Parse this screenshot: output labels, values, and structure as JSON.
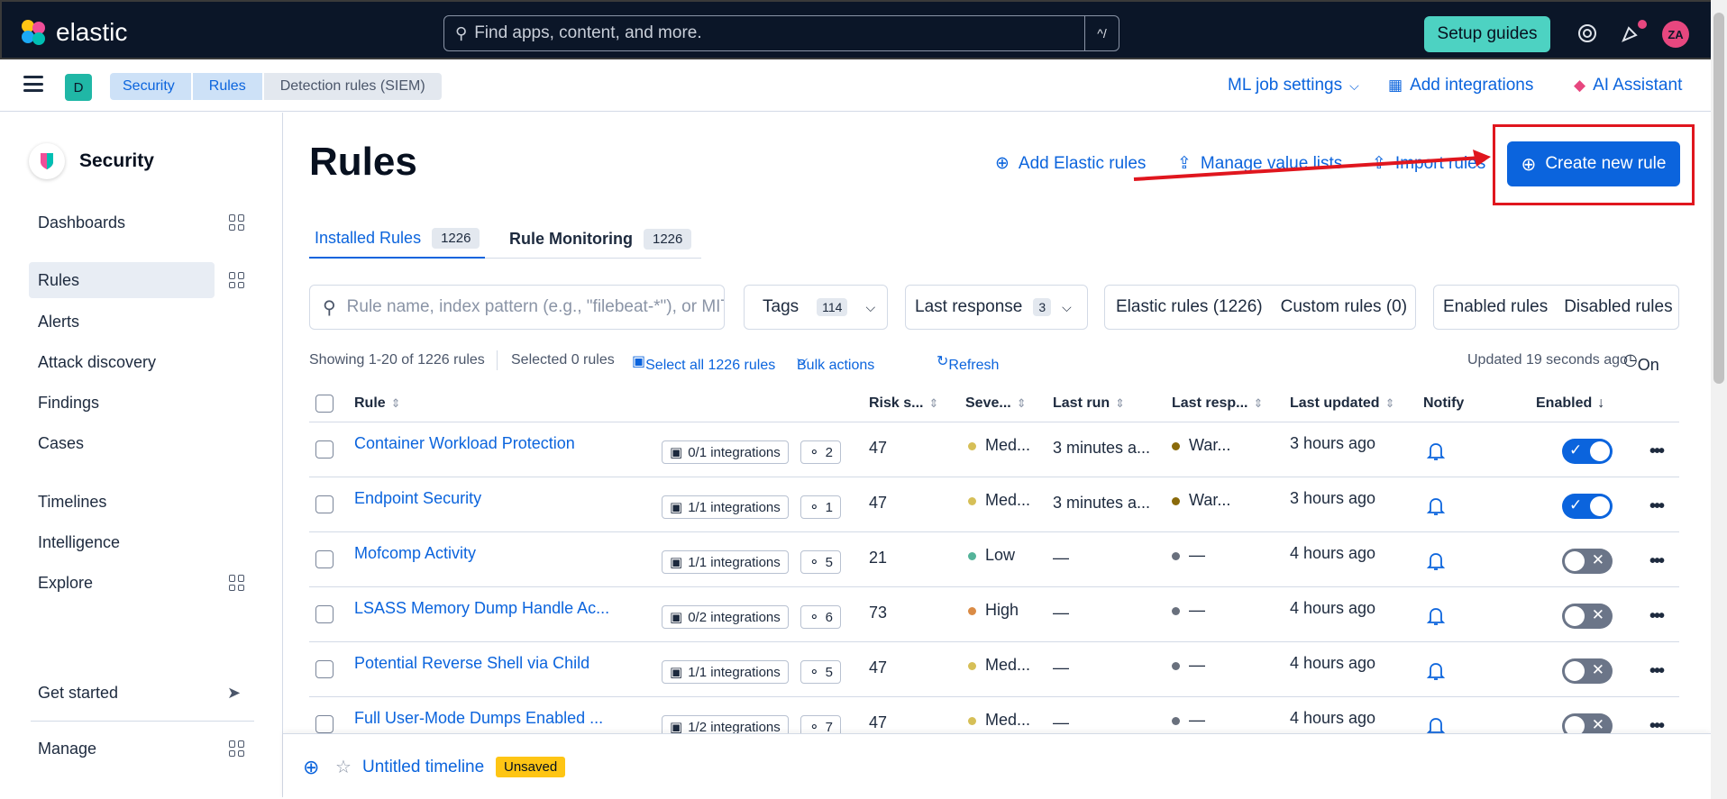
{
  "header": {
    "logo_text": "elastic",
    "search_placeholder": "Find apps, content, and more.",
    "search_shortcut": "^/",
    "setup_guides_label": "Setup guides",
    "avatar_initials": "ZA"
  },
  "subheader": {
    "space_initial": "D",
    "breadcrumbs": [
      "Security",
      "Rules",
      "Detection rules (SIEM)"
    ],
    "ml_job_settings": "ML job settings",
    "add_integrations": "Add integrations",
    "ai_assistant": "AI Assistant"
  },
  "sidebar": {
    "title": "Security",
    "items": [
      "Dashboards",
      "Rules",
      "Alerts",
      "Attack discovery",
      "Findings",
      "Cases",
      "Timelines",
      "Intelligence",
      "Explore",
      "Get started",
      "Manage"
    ],
    "active": "Rules"
  },
  "page": {
    "title": "Rules",
    "add_elastic_rules": "Add Elastic rules",
    "manage_value_lists": "Manage value lists",
    "import_rules": "Import rules",
    "create_new_rule": "Create new rule"
  },
  "tabs": [
    {
      "label": "Installed Rules",
      "count": "1226"
    },
    {
      "label": "Rule Monitoring",
      "count": "1226"
    }
  ],
  "filters": {
    "search_placeholder": "Rule name, index pattern (e.g., \"filebeat-*\"), or MITRE ATT&CK™ tactic or technique (e.g., \"Defense Evasion\" or \"TA0005\")",
    "tags_label": "Tags",
    "tags_count": "114",
    "last_response_label": "Last response",
    "last_response_count": "3",
    "elastic_rules": "Elastic rules (1226)",
    "custom_rules": "Custom rules (0)",
    "enabled_rules": "Enabled rules",
    "disabled_rules": "Disabled rules"
  },
  "info": {
    "showing": "Showing 1-20 of 1226 rules",
    "selected": "Selected 0 rules",
    "select_all": "Select all 1226 rules",
    "bulk_actions": "Bulk actions",
    "refresh": "Refresh",
    "updated": "Updated 19 seconds ago",
    "auto_refresh": "On"
  },
  "table": {
    "columns": [
      "Rule",
      "Risk s...",
      "Seve...",
      "Last run",
      "Last resp...",
      "Last updated",
      "Notify",
      "Enabled"
    ],
    "rows": [
      {
        "name": "Container Workload Protection",
        "integrations": "0/1 integrations",
        "tags": "2",
        "risk": "47",
        "severity": "Med...",
        "severity_color": "#d6bf57",
        "last_run": "3 minutes a...",
        "last_response": "War...",
        "response_color": "#8a6a0a",
        "updated": "3 hours ago",
        "enabled": true
      },
      {
        "name": "Endpoint Security",
        "integrations": "1/1 integrations",
        "tags": "1",
        "risk": "47",
        "severity": "Med...",
        "severity_color": "#d6bf57",
        "last_run": "3 minutes a...",
        "last_response": "War...",
        "response_color": "#8a6a0a",
        "updated": "3 hours ago",
        "enabled": true
      },
      {
        "name": "Mofcomp Activity",
        "integrations": "1/1 integrations",
        "tags": "5",
        "risk": "21",
        "severity": "Low",
        "severity_color": "#54b399",
        "last_run": "—",
        "last_response": "—",
        "response_color": "#69707d",
        "updated": "4 hours ago",
        "enabled": false
      },
      {
        "name": "LSASS Memory Dump Handle Ac...",
        "integrations": "0/2 integrations",
        "tags": "6",
        "risk": "73",
        "severity": "High",
        "severity_color": "#da8b45",
        "last_run": "—",
        "last_response": "—",
        "response_color": "#69707d",
        "updated": "4 hours ago",
        "enabled": false
      },
      {
        "name": "Potential Reverse Shell via Child",
        "integrations": "1/1 integrations",
        "tags": "5",
        "risk": "47",
        "severity": "Med...",
        "severity_color": "#d6bf57",
        "last_run": "—",
        "last_response": "—",
        "response_color": "#69707d",
        "updated": "4 hours ago",
        "enabled": false
      },
      {
        "name": "Full User-Mode Dumps Enabled ...",
        "integrations": "1/2 integrations",
        "tags": "7",
        "risk": "47",
        "severity": "Med...",
        "severity_color": "#d6bf57",
        "last_run": "—",
        "last_response": "—",
        "response_color": "#69707d",
        "updated": "4 hours ago",
        "enabled": false
      }
    ]
  },
  "timeline": {
    "name": "Untitled timeline",
    "status": "Unsaved"
  }
}
